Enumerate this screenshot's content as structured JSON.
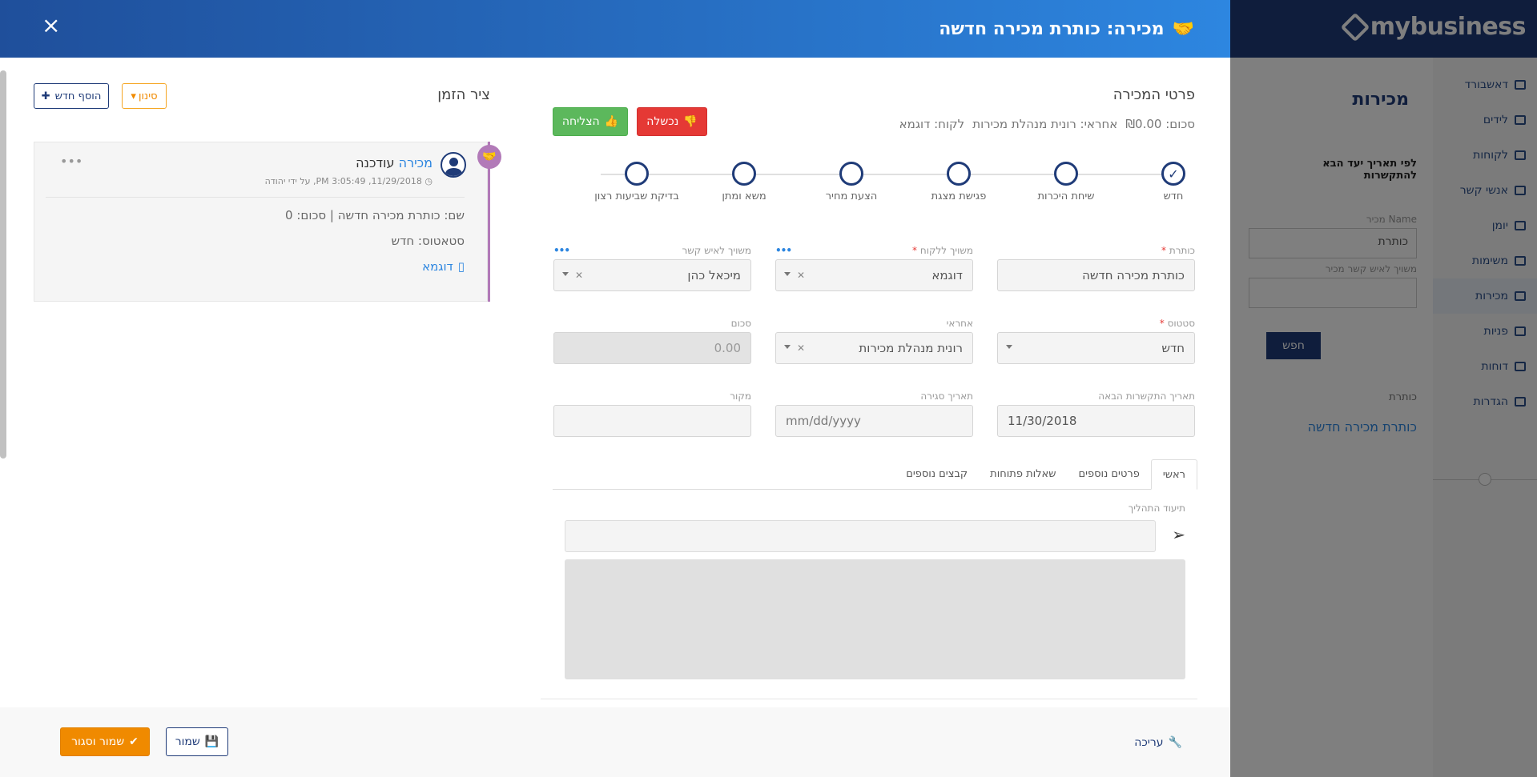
{
  "background": {
    "logo_text": "mybusiness",
    "page_title": "מכירות",
    "nav_items": [
      {
        "label": "דאשבורד",
        "icon": "chart-icon"
      },
      {
        "label": "לידים",
        "icon": "megaphone-icon"
      },
      {
        "label": "לקוחות",
        "icon": "building-icon"
      },
      {
        "label": "אנשי קשר",
        "icon": "user-icon"
      },
      {
        "label": "יומן",
        "icon": "calendar-icon"
      },
      {
        "label": "משימות",
        "icon": "list-icon"
      },
      {
        "label": "מכירות",
        "icon": "handshake-icon",
        "active": true
      },
      {
        "label": "פניות",
        "icon": "headset-icon"
      },
      {
        "label": "דוחות",
        "icon": "file-icon"
      },
      {
        "label": "הגדרות",
        "icon": "gear-icon"
      }
    ],
    "filter_label": "לפי תאריך יעד הבא להתקשרות",
    "name_label": "Name מכיר",
    "name_value": "כותרת",
    "contact_label": "משויך לאיש קשר מכיר",
    "search_button": "חפש",
    "column_header": "כותרת",
    "row_value": "כותרת מכירה חדשה"
  },
  "modal": {
    "title": "מכירה: כותרת מכירה חדשה",
    "close": "×"
  },
  "form": {
    "section_title": "פרטי המכירה",
    "summary": {
      "amount": "סכום: ₪0.00",
      "owner": "אחראי: רונית מנהלת מכירות",
      "client": "לקוח: דוגמא"
    },
    "lost_label": "נכשלה",
    "won_label": "הצליחה",
    "stages": [
      {
        "label": "חדש",
        "done": true
      },
      {
        "label": "שיחת היכרות",
        "done": false
      },
      {
        "label": "פגישת מצגת",
        "done": false
      },
      {
        "label": "הצעת מחיר",
        "done": false
      },
      {
        "label": "משא ומתן",
        "done": false
      },
      {
        "label": "בדיקת שביעות רצון",
        "done": false
      }
    ],
    "fields": {
      "title_label": "כותרת",
      "title_value": "כותרת מכירה חדשה",
      "client_label": "משויך ללקוח",
      "client_value": "דוגמא",
      "contact_label": "משויך לאיש קשר",
      "contact_value": "מיכאל כהן",
      "status_label": "סטטוס",
      "status_value": "חדש",
      "owner_label": "אחראי",
      "owner_value": "רונית מנהלת מכירות",
      "amount_label": "סכום",
      "amount_value": "0.00",
      "next_contact_label": "תאריך התקשרות הבאה",
      "next_contact_value": "11/30/2018",
      "close_date_label": "תאריך סגירה",
      "close_date_placeholder": "mm/dd/yyyy",
      "source_label": "מקור",
      "source_value": ""
    },
    "tabs": [
      "ראשי",
      "פרטים נוספים",
      "שאלות פתוחות",
      "קבצים נוספים"
    ],
    "active_tab": "ראשי",
    "doc_label": "תיעוד התהליך"
  },
  "timeline": {
    "title": "ציר הזמן",
    "filter_label": "סינון",
    "add_label": "הוסף חדש",
    "entry": {
      "type_link": "מכירה",
      "action": "עודכנה",
      "meta": "11/29/2018, 3:05:49 PM, על ידי יהודה",
      "name_line": "שם: כותרת מכירה חדשה | סכום: 0",
      "status_line": "סטאטוס: חדש",
      "client": "דוגמא"
    }
  },
  "footer": {
    "edit_label": "עריכה",
    "save_label": "שמור",
    "save_close_label": "שמור וסגור"
  }
}
